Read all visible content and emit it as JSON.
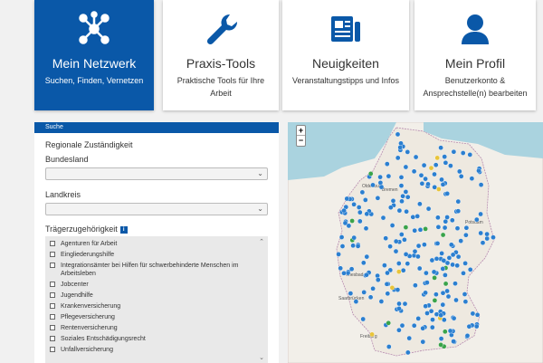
{
  "nav": {
    "tiles": [
      {
        "title": "Mein Netzwerk",
        "subtitle": "Suchen, Finden, Vernetzen",
        "icon": "network-icon",
        "active": true
      },
      {
        "title": "Praxis-Tools",
        "subtitle": "Praktische Tools für Ihre Arbeit",
        "icon": "wrench-icon",
        "active": false
      },
      {
        "title": "Neuigkeiten",
        "subtitle": "Veranstaltungstipps und Infos",
        "icon": "newspaper-icon",
        "active": false
      },
      {
        "title": "Mein Profil",
        "subtitle": "Benutzerkonto & Ansprechstelle(n) bearbeiten",
        "icon": "user-icon",
        "active": false
      }
    ]
  },
  "search": {
    "panel_title": "Suche",
    "section_title": "Regionale Zuständigkeit",
    "bundesland_label": "Bundesland",
    "bundesland_value": "",
    "landkreis_label": "Landkreis",
    "landkreis_value": "",
    "traeger_label": "Trägerzugehörigkeit",
    "info_icon": "info-icon",
    "traeger_options": [
      "Agenturen für Arbeit",
      "Eingliederungshilfe",
      "Integrationsämter bei Hilfen für schwerbehinderte Menschen im Arbeitsleben",
      "Jobcenter",
      "Jugendhilfe",
      "Krankenversicherung",
      "Pflegeversicherung",
      "Rentenversicherung",
      "Soziales Entschädigungsrecht",
      "Unfallversicherung"
    ]
  },
  "map": {
    "zoom_in": "+",
    "zoom_out": "−",
    "cities": [
      "Oldenburg",
      "Bremen",
      "Potsdam",
      "Wiesbaden",
      "Saarbrücken",
      "Freiburg"
    ],
    "colors": {
      "water": "#aad3df",
      "land": "#f2efe9",
      "marker_blue": "#2b7fd0",
      "marker_green": "#3aa34a",
      "marker_yellow": "#e8c43a"
    }
  },
  "colors": {
    "brand": "#0a58a8",
    "background": "#f1f1f1"
  }
}
